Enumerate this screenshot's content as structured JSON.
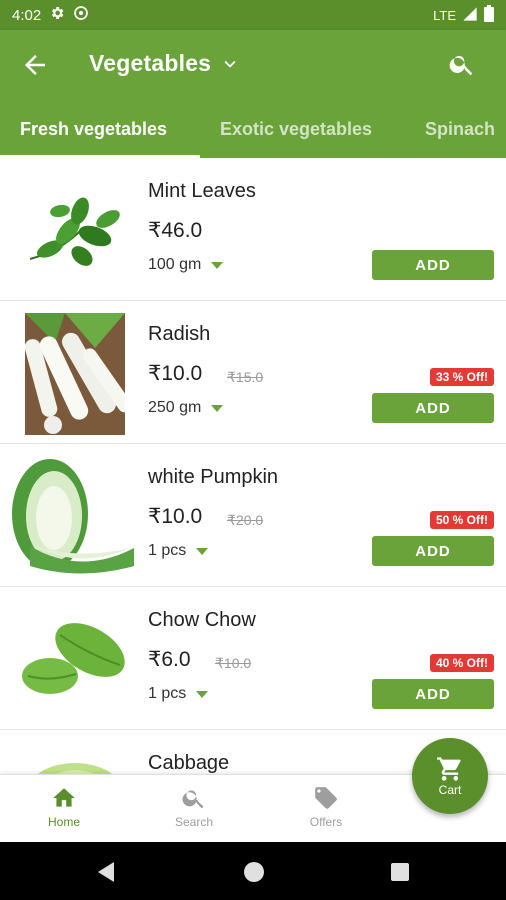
{
  "status_bar": {
    "time": "4:02",
    "network": "LTE"
  },
  "app_bar": {
    "title": "Vegetables"
  },
  "tabs": [
    {
      "label": "Fresh vegetables",
      "active": true
    },
    {
      "label": "Exotic vegetables",
      "active": false
    },
    {
      "label": "Spinach",
      "active": false
    }
  ],
  "products": [
    {
      "name": "Mint Leaves",
      "price": "₹46.0",
      "mrp": "",
      "unit": "100 gm",
      "discount": "",
      "add_label": "ADD"
    },
    {
      "name": "Radish",
      "price": "₹10.0",
      "mrp": "₹15.0",
      "unit": "250 gm",
      "discount": "33 % Off!",
      "add_label": "ADD"
    },
    {
      "name": "white Pumpkin",
      "price": "₹10.0",
      "mrp": "₹20.0",
      "unit": "1 pcs",
      "discount": "50 % Off!",
      "add_label": "ADD"
    },
    {
      "name": "Chow Chow",
      "price": "₹6.0",
      "mrp": "₹10.0",
      "unit": "1 pcs",
      "discount": "40 % Off!",
      "add_label": "ADD"
    },
    {
      "name": "Cabbage"
    }
  ],
  "bottom_nav": {
    "home": "Home",
    "search": "Search",
    "offers": "Offers"
  },
  "cart": {
    "label": "Cart"
  },
  "colors": {
    "primary": "#6aa33a",
    "primary_dark": "#5a8f2c",
    "discount": "#e53935"
  },
  "icons": [
    "settings-icon",
    "lte-signal-icon",
    "battery-icon",
    "back-arrow-icon",
    "chevron-down-icon",
    "search-icon",
    "home-icon",
    "tag-icon",
    "cart-icon"
  ]
}
